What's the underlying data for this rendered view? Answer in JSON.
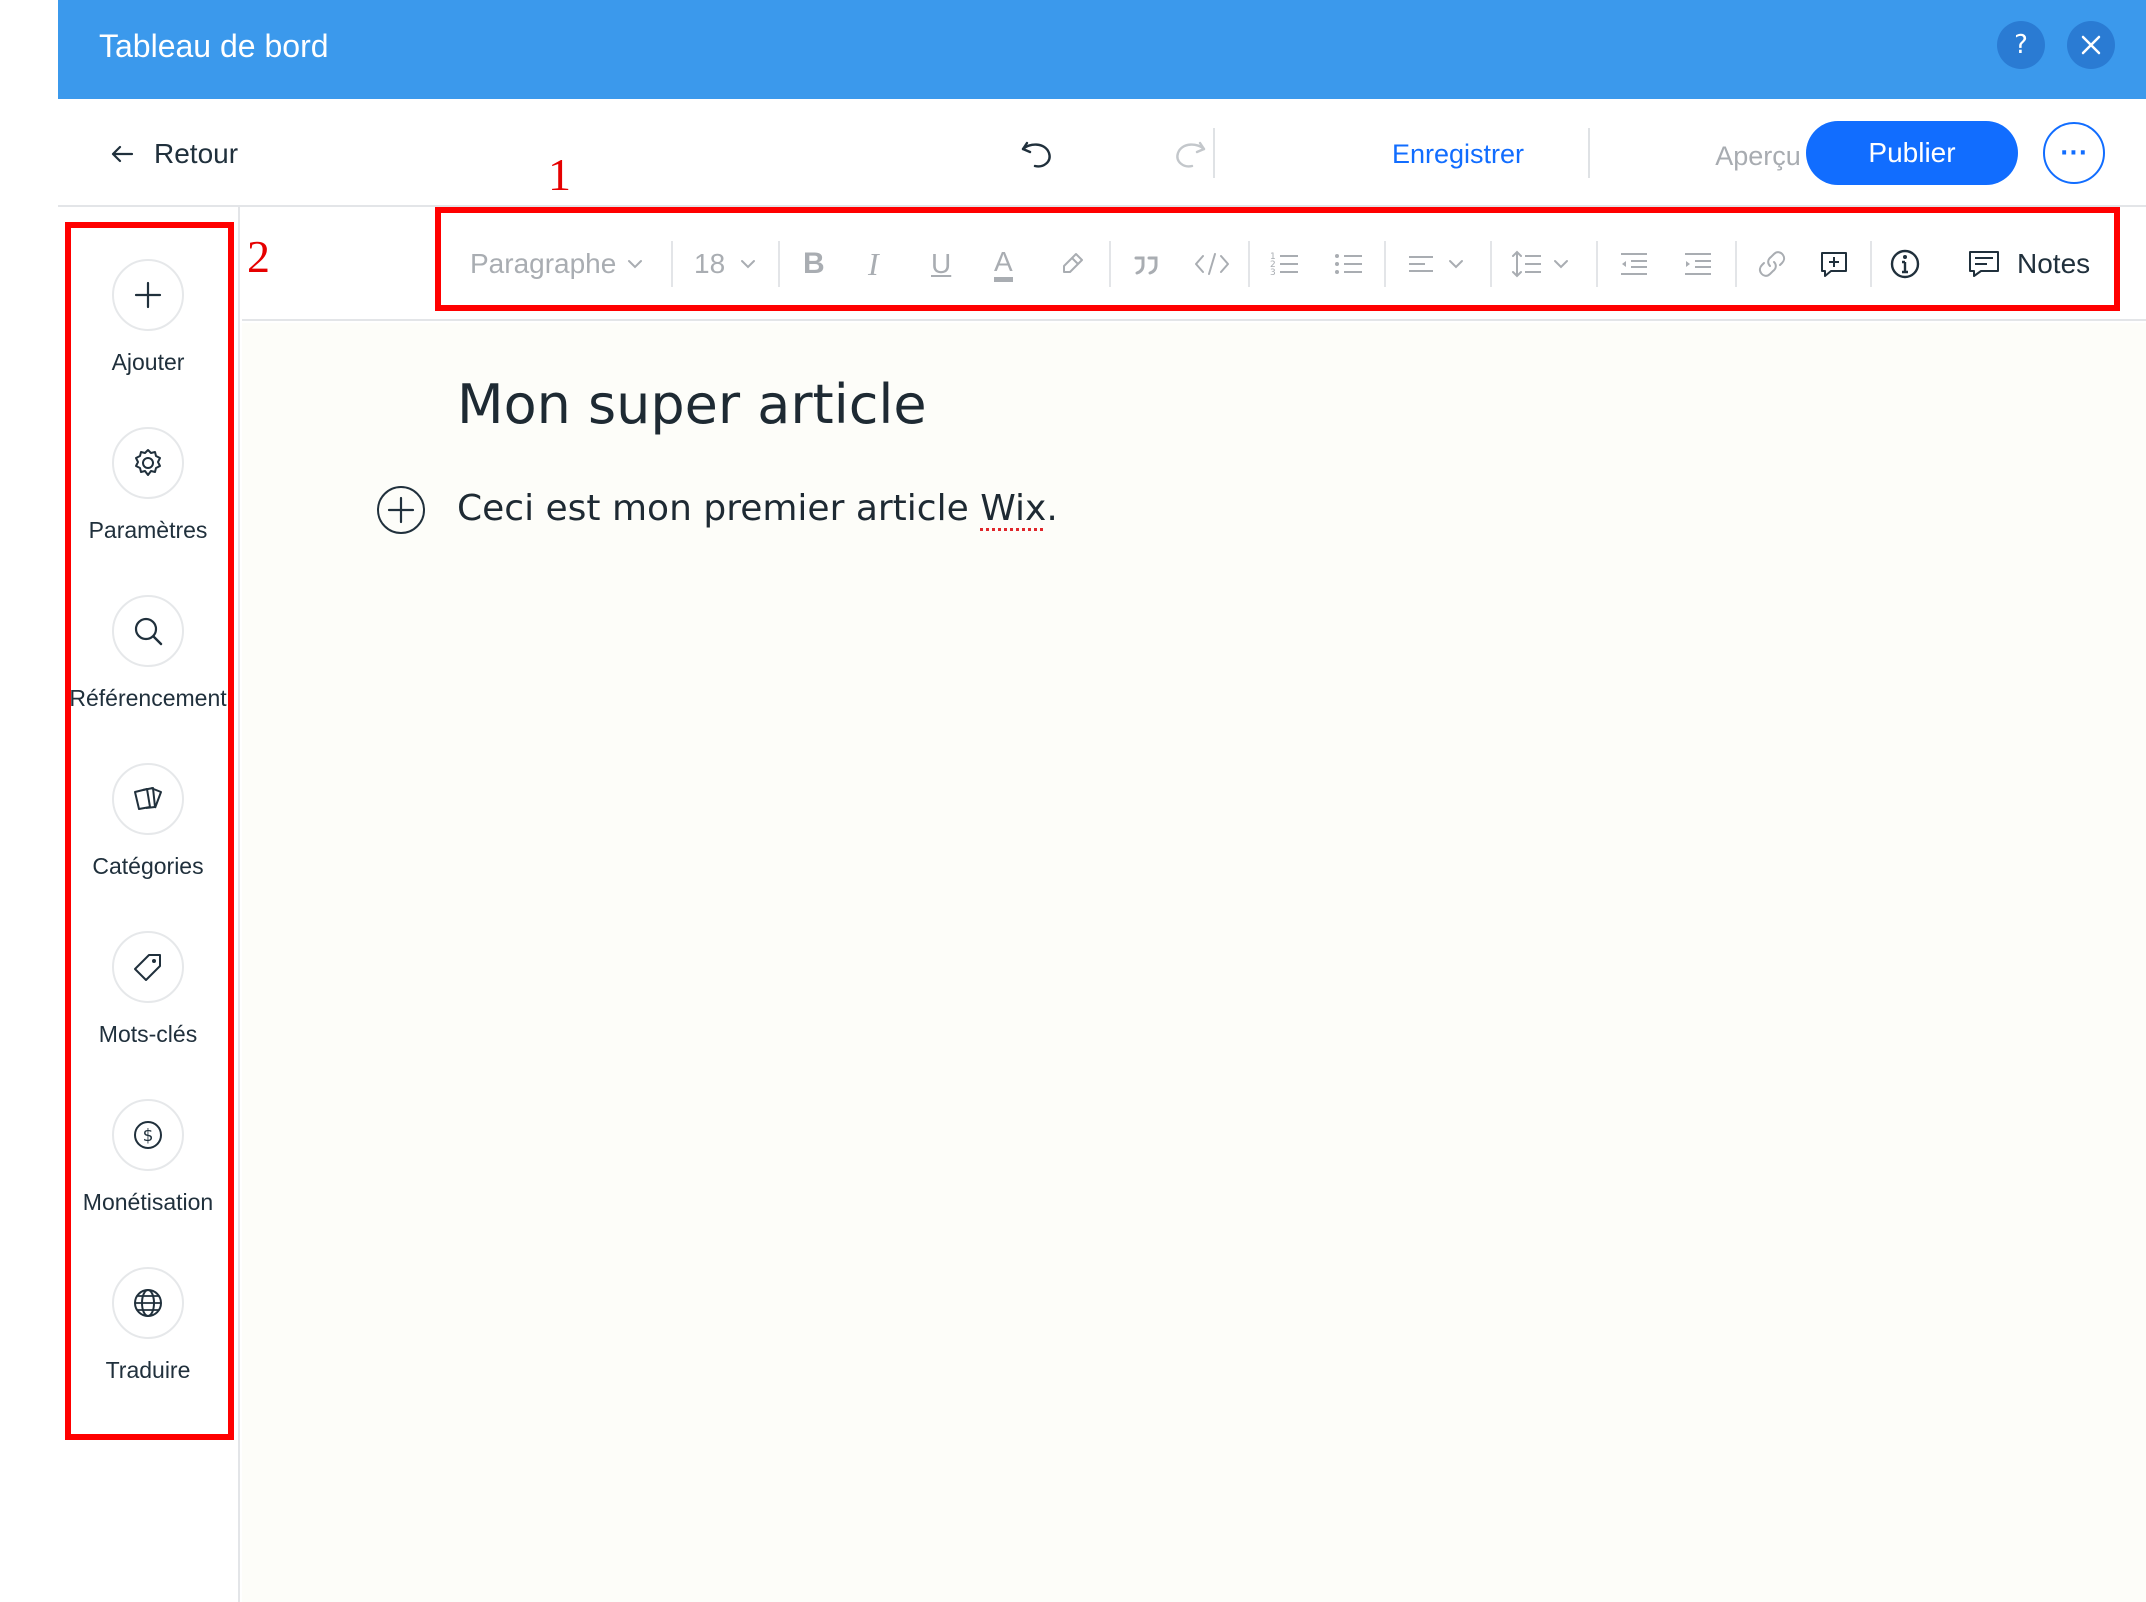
{
  "window": {
    "title": "Tableau de bord",
    "help_label": "?"
  },
  "header": {
    "back_label": "Retour",
    "save_label": "Enregistrer",
    "preview_label": "Aperçu",
    "publish_label": "Publier",
    "more_label": "···"
  },
  "sidebar": {
    "items": [
      {
        "label": "Ajouter",
        "icon": "plus-icon"
      },
      {
        "label": "Paramètres",
        "icon": "gear-icon"
      },
      {
        "label": "Référencement",
        "icon": "search-icon"
      },
      {
        "label": "Catégories",
        "icon": "categories-icon"
      },
      {
        "label": "Mots-clés",
        "icon": "tag-icon"
      },
      {
        "label": "Monétisation",
        "icon": "dollar-icon"
      },
      {
        "label": "Traduire",
        "icon": "globe-icon"
      }
    ]
  },
  "format_toolbar": {
    "paragraph_label": "Paragraphe",
    "font_size": "18",
    "bold_label": "B",
    "italic_label": "I",
    "underline_label": "U",
    "text_color_label": "A",
    "notes_label": "Notes"
  },
  "editor": {
    "title": "Mon super article",
    "body_text": "Ceci est mon premier article ",
    "body_misspelled": "Wix",
    "body_end": "."
  },
  "annotations": {
    "box1_label": "1",
    "box2_label": "2"
  },
  "colors": {
    "brand_blue": "#3b99ec",
    "accent_blue": "#116dff",
    "annotation_red": "#ff0000"
  }
}
